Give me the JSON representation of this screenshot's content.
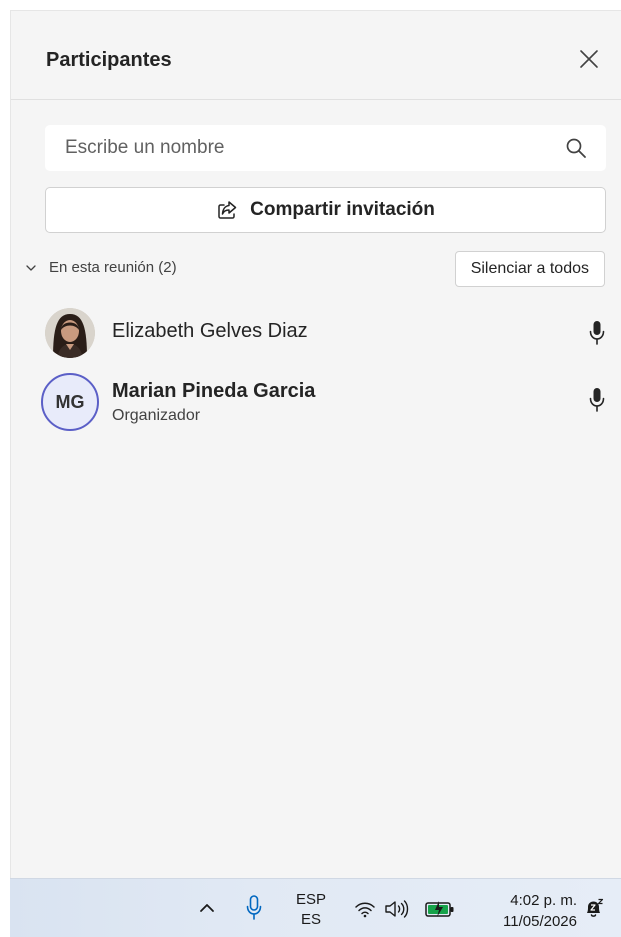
{
  "panel": {
    "title": "Participantes"
  },
  "search": {
    "placeholder": "Escribe un nombre",
    "value": ""
  },
  "share": {
    "label": "Compartir invitación"
  },
  "section": {
    "label": "En esta reunión (2)",
    "mute_all_label": "Silenciar a todos"
  },
  "participants": [
    {
      "name": "Elizabeth Gelves Diaz",
      "role": "",
      "avatar": "photo",
      "mic": "on"
    },
    {
      "name": "Marian Pineda Garcia",
      "role": "Organizador",
      "initials": "MG",
      "avatar": "initials",
      "mic": "on"
    }
  ],
  "taskbar": {
    "lang_top": "ESP",
    "lang_bottom": "ES",
    "time": "4:02 p. m.",
    "date": "11/05/2026"
  },
  "icons": {
    "close": "close-icon",
    "search": "search-icon",
    "share": "share-icon",
    "chevron": "chevron-down-icon",
    "mic": "microphone-icon"
  },
  "colors": {
    "accent": "#5b5fc7",
    "panel_bg": "#f5f5f5",
    "taskbar_mic": "#0067c0"
  }
}
